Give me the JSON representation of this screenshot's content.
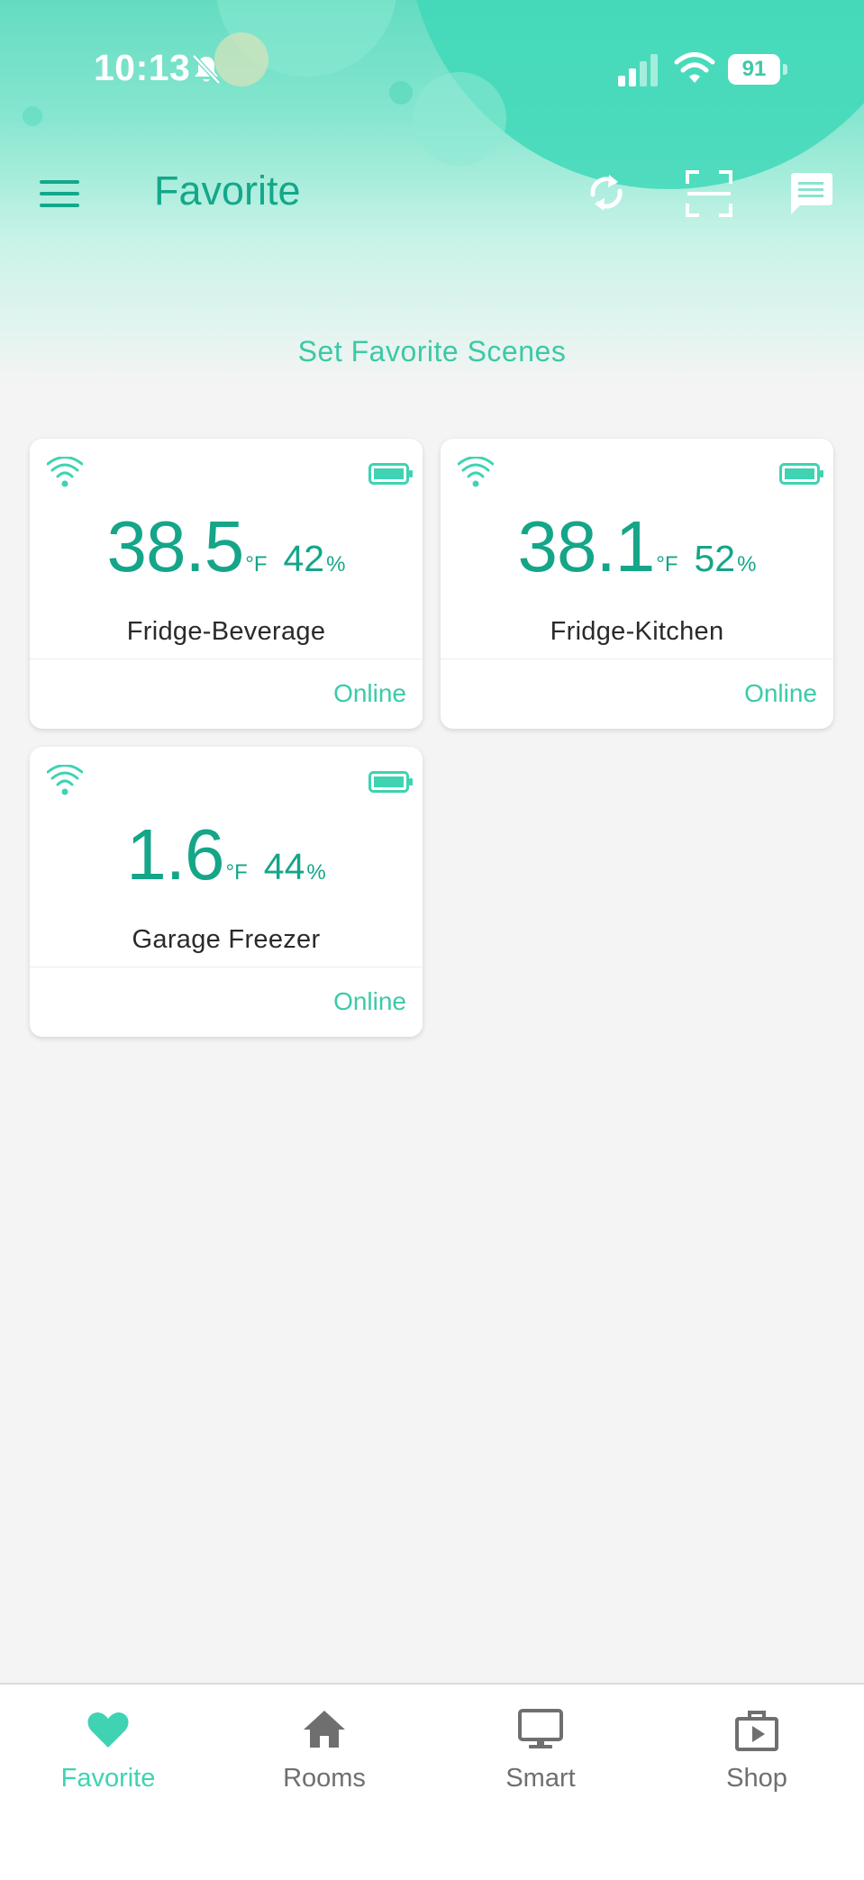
{
  "status_bar": {
    "time": "10:13",
    "battery_level": "91",
    "icons": [
      "bell-off-icon",
      "cellular-signal-icon",
      "wifi-icon",
      "battery-icon"
    ]
  },
  "header": {
    "title": "Favorite",
    "icons": [
      "menu-icon",
      "refresh-icon",
      "scan-icon",
      "message-icon"
    ],
    "scenes_link": "Set Favorite Scenes"
  },
  "devices": [
    {
      "temperature": "38.5",
      "temperature_unit": "°F",
      "humidity": "42",
      "humidity_unit": "%",
      "name": "Fridge-Beverage",
      "status": "Online"
    },
    {
      "temperature": "38.1",
      "temperature_unit": "°F",
      "humidity": "52",
      "humidity_unit": "%",
      "name": "Fridge-Kitchen",
      "status": "Online"
    },
    {
      "temperature": "1.6",
      "temperature_unit": "°F",
      "humidity": "44",
      "humidity_unit": "%",
      "name": "Garage Freezer",
      "status": "Online"
    }
  ],
  "bottom_nav": {
    "items": [
      {
        "label": "Favorite",
        "icon": "heart-icon",
        "active": true
      },
      {
        "label": "Rooms",
        "icon": "home-icon",
        "active": false
      },
      {
        "label": "Smart",
        "icon": "monitor-icon",
        "active": false
      },
      {
        "label": "Shop",
        "icon": "shop-icon",
        "active": false
      }
    ]
  },
  "colors": {
    "accent": "#3fd3b3",
    "accent_dark": "#15a588",
    "header_top": "#64dcc1",
    "background": "#f4f4f4",
    "inactive": "#6f6f6f"
  }
}
